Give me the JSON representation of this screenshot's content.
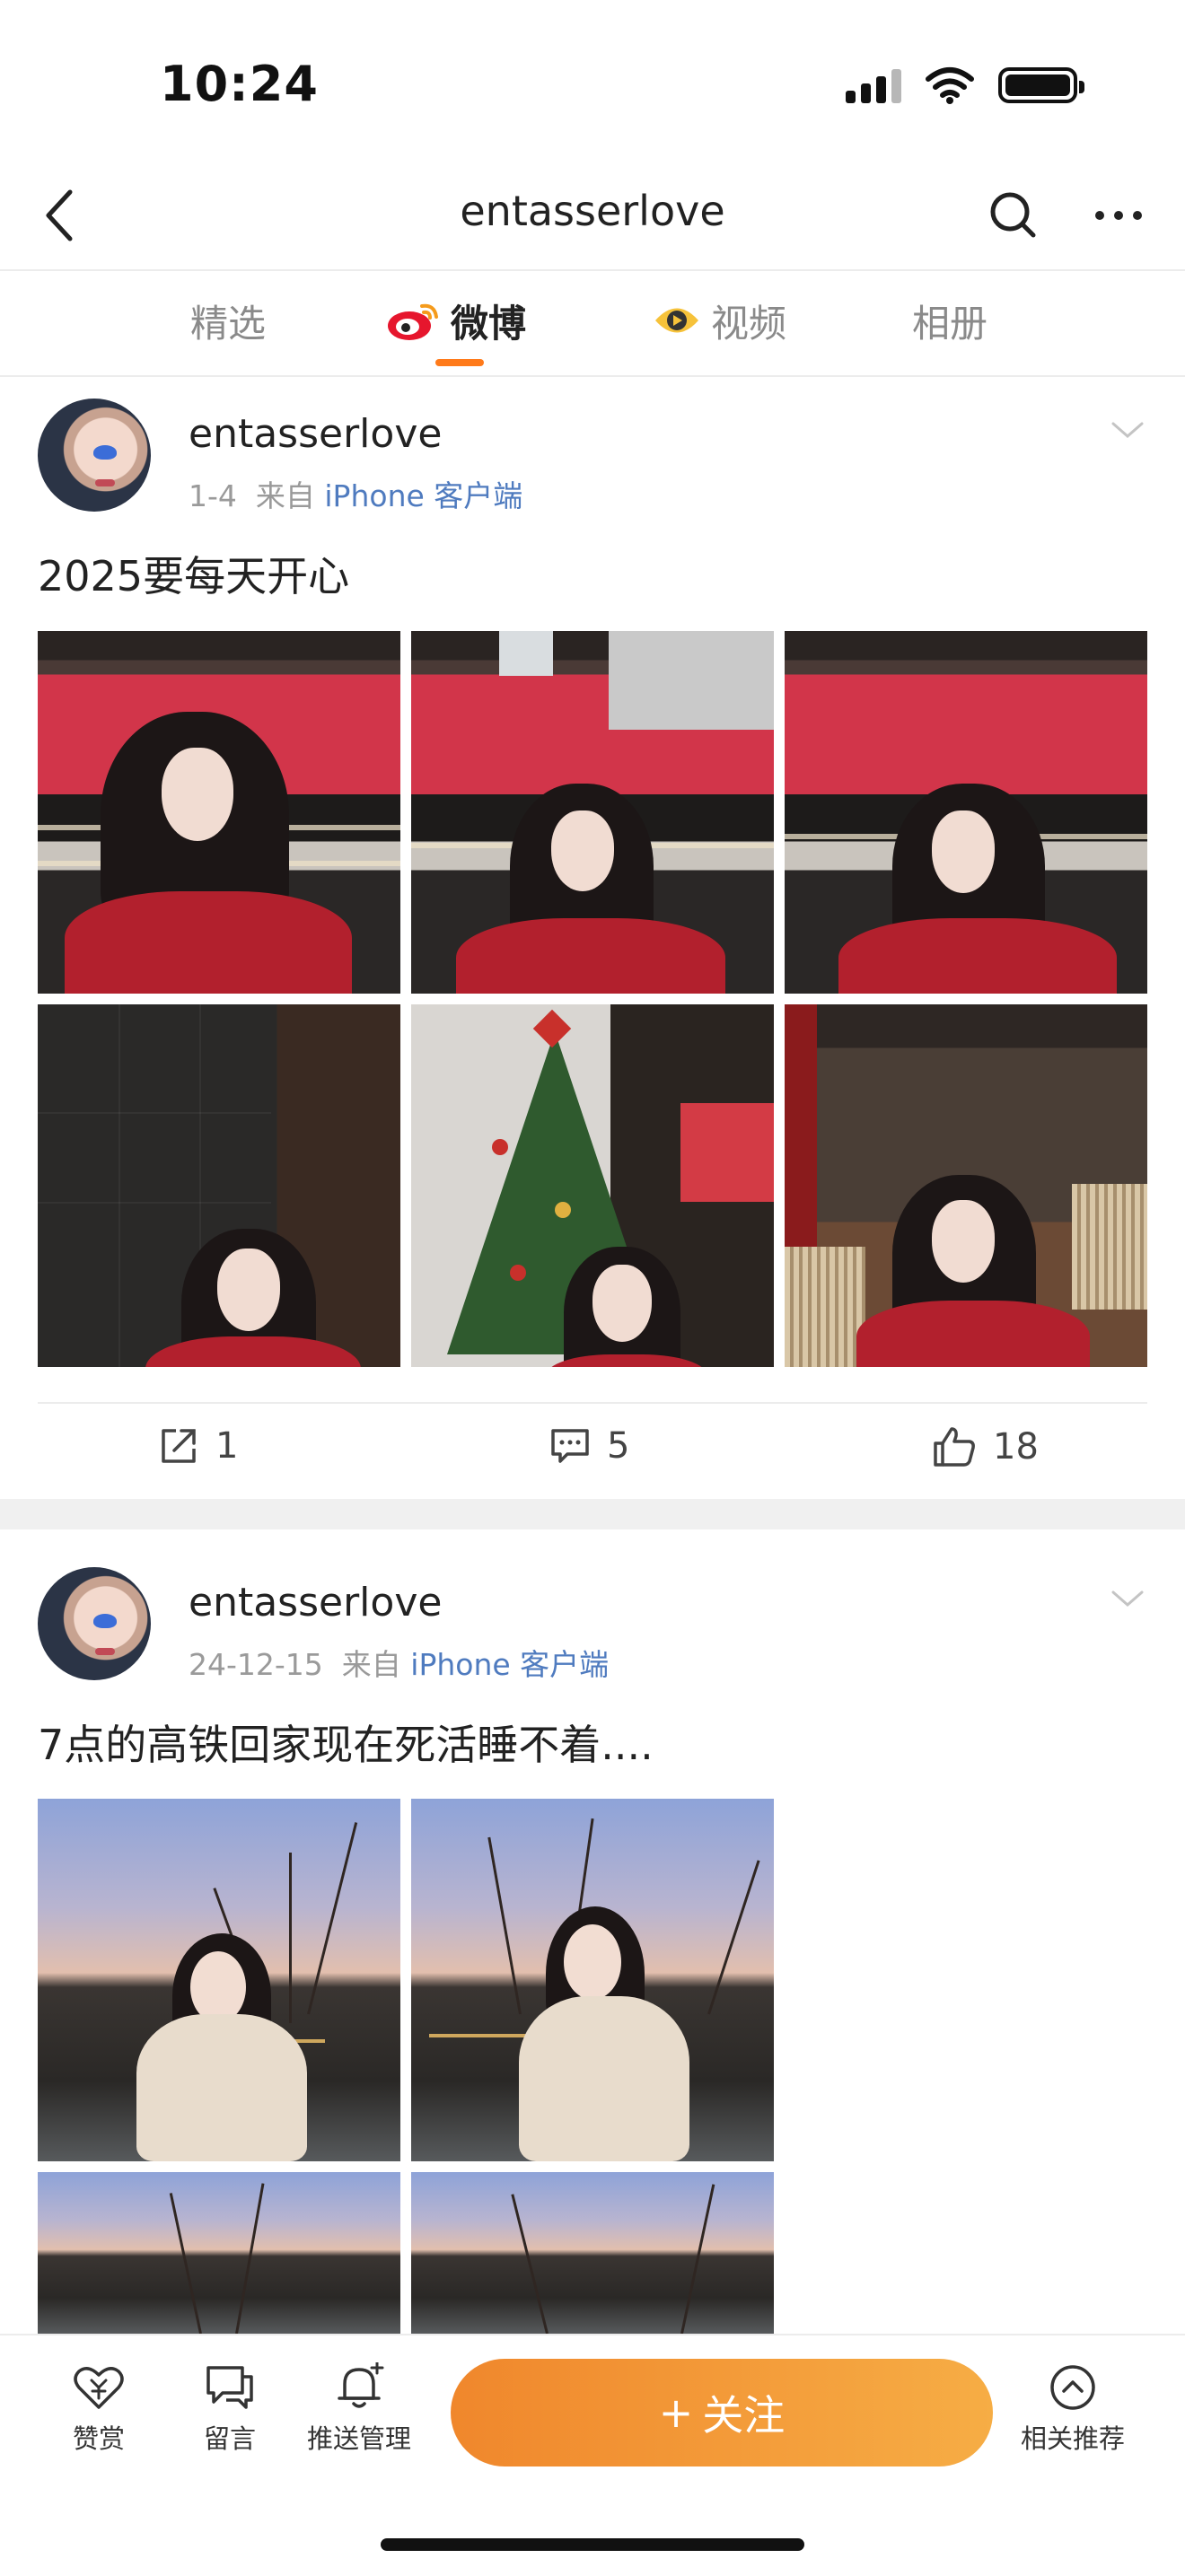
{
  "status_bar": {
    "time": "10:24"
  },
  "nav": {
    "title": "entasserlove"
  },
  "tabs": [
    {
      "label": "精选",
      "active": false
    },
    {
      "label": "微博",
      "active": true,
      "icon": "weibo-logo-icon"
    },
    {
      "label": "视频",
      "active": false,
      "icon": "video-eye-icon"
    },
    {
      "label": "相册",
      "active": false
    }
  ],
  "posts": [
    {
      "username": "entasserlove",
      "date": "1-4",
      "from_label": "来自",
      "source": "iPhone 客户端",
      "text": "2025要每天开心",
      "photos": [
        "bar-selfie-1",
        "bar-selfie-2",
        "bar-selfie-3",
        "dark-wall-portrait",
        "christmas-tree-portrait",
        "cafe-chair-portrait"
      ],
      "reposts": "1",
      "comments": "5",
      "likes": "18"
    },
    {
      "username": "entasserlove",
      "date": "24-12-15",
      "from_label": "来自",
      "source": "iPhone 客户端",
      "text": "7点的高铁回家现在死活睡不着....",
      "photos": [
        "dusk-coat-1",
        "dusk-coat-2",
        "dusk-coat-3",
        "dusk-coat-4"
      ]
    }
  ],
  "bottom_bar": {
    "reward": "赞赏",
    "message": "留言",
    "push": "推送管理",
    "follow": "关注",
    "follow_prefix": "+",
    "recommend": "相关推荐"
  },
  "colors": {
    "accent": "#ff7a1a",
    "link": "#4f7bbf",
    "follow_start": "#f0872c",
    "follow_end": "#f6ad45"
  }
}
